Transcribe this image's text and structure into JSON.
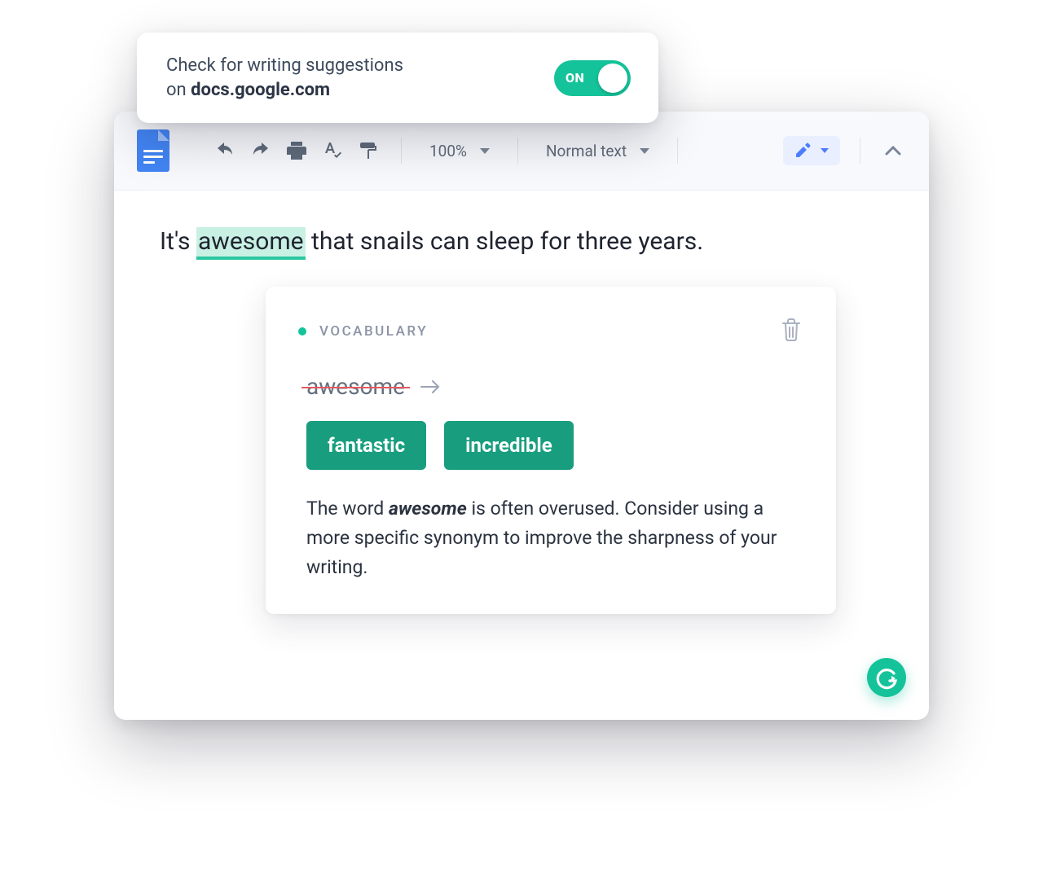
{
  "extension": {
    "prefix": "Check for writing suggestions",
    "on_prefix": "on ",
    "domain": "docs.google.com",
    "toggle_label": "ON"
  },
  "toolbar": {
    "zoom": "100%",
    "style": "Normal text"
  },
  "document": {
    "sentence_before": "It's ",
    "highlighted": "awesome",
    "sentence_after": " that snails can sleep for three years."
  },
  "suggestion": {
    "category": "VOCABULARY",
    "original": "awesome",
    "alternatives": [
      "fantastic",
      "incredible"
    ],
    "explain_before": "The word ",
    "explain_word": "awesome",
    "explain_after": " is often overused. Consider using a more specific synonym to improve the sharpness of your writing."
  }
}
